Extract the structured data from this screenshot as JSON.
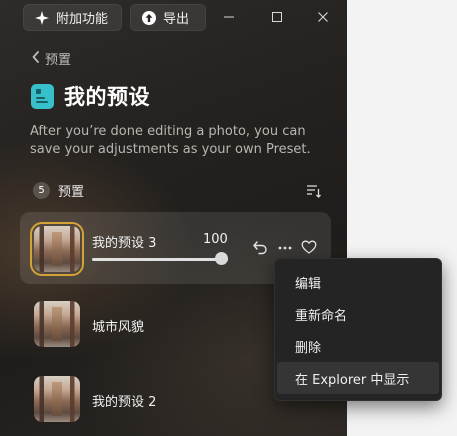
{
  "toolbar": {
    "addons_label": "附加功能",
    "export_label": "导出"
  },
  "nav": {
    "back_label": "预置"
  },
  "page": {
    "title": "我的预设",
    "description": "After you’re done editing a photo, you can save your adjustments as your own Preset."
  },
  "section": {
    "count": "5",
    "label": "预置"
  },
  "presets": [
    {
      "name": "我的预设 3",
      "strength": "100",
      "strength_fraction": 1.0,
      "selected": true
    },
    {
      "name": "城市风貌"
    },
    {
      "name": "我的预设 2"
    }
  ],
  "context_menu": {
    "items": [
      {
        "label": "编辑"
      },
      {
        "label": "重新命名"
      },
      {
        "label": "删除"
      },
      {
        "label": "在 Explorer 中显示"
      }
    ]
  },
  "icons": {
    "addons": "sparkle-icon",
    "export": "upload-icon",
    "minimize": "minimize-icon",
    "maximize": "maximize-icon",
    "close": "close-icon",
    "back": "chevron-left-icon",
    "title": "preset-book-icon",
    "sort": "sort-icon",
    "undo": "undo-icon",
    "more": "more-icon",
    "favorite": "heart-icon"
  },
  "colors": {
    "accent_selection": "#d4a237",
    "title_icon": "#37c0c9",
    "panel_background": "#24211f",
    "menu_background": "#242424"
  }
}
